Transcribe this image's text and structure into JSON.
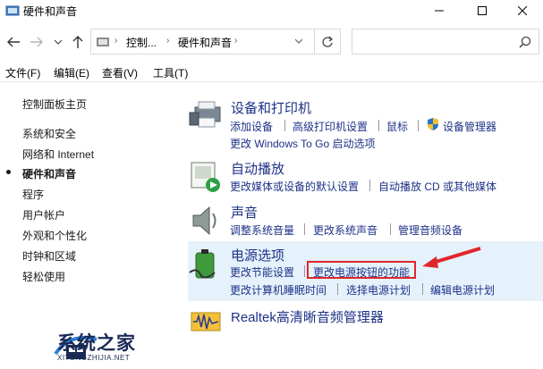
{
  "window": {
    "title": "硬件和声音"
  },
  "address": {
    "crumbs": [
      "控制...",
      "硬件和声音"
    ],
    "search_placeholder": ""
  },
  "menu": [
    "文件(F)",
    "编辑(E)",
    "查看(V)",
    "工具(T)"
  ],
  "sidebar": {
    "items": [
      {
        "label": "控制面板主页"
      },
      {
        "label": "系统和安全"
      },
      {
        "label": "网络和 Internet"
      },
      {
        "label": "硬件和声音",
        "active": true
      },
      {
        "label": "程序"
      },
      {
        "label": "用户帐户"
      },
      {
        "label": "外观和个性化"
      },
      {
        "label": "时钟和区域"
      },
      {
        "label": "轻松使用"
      }
    ]
  },
  "categories": {
    "devices": {
      "title": "设备和打印机",
      "links": [
        "添加设备",
        "高级打印机设置",
        "鼠标",
        "设备管理器",
        "更改 Windows To Go 启动选项"
      ]
    },
    "autoplay": {
      "title": "自动播放",
      "links": [
        "更改媒体或设备的默认设置",
        "自动播放 CD 或其他媒体"
      ]
    },
    "sound": {
      "title": "声音",
      "links": [
        "调整系统音量",
        "更改系统声音",
        "管理音频设备"
      ]
    },
    "power": {
      "title": "电源选项",
      "links": [
        "更改节能设置",
        "更改电源按钮的功能",
        "更改计算机睡眠时间",
        "选择电源计划",
        "编辑电源计划"
      ]
    },
    "realtek": {
      "title": "Realtek高清晰音频管理器"
    }
  },
  "watermark": {
    "text": "系统之家",
    "sub": "XITONGZHIJIA.NET"
  },
  "colors": {
    "link": "#1e3287",
    "highlight": "#e5f1fb",
    "annotation": "#e0262b"
  }
}
